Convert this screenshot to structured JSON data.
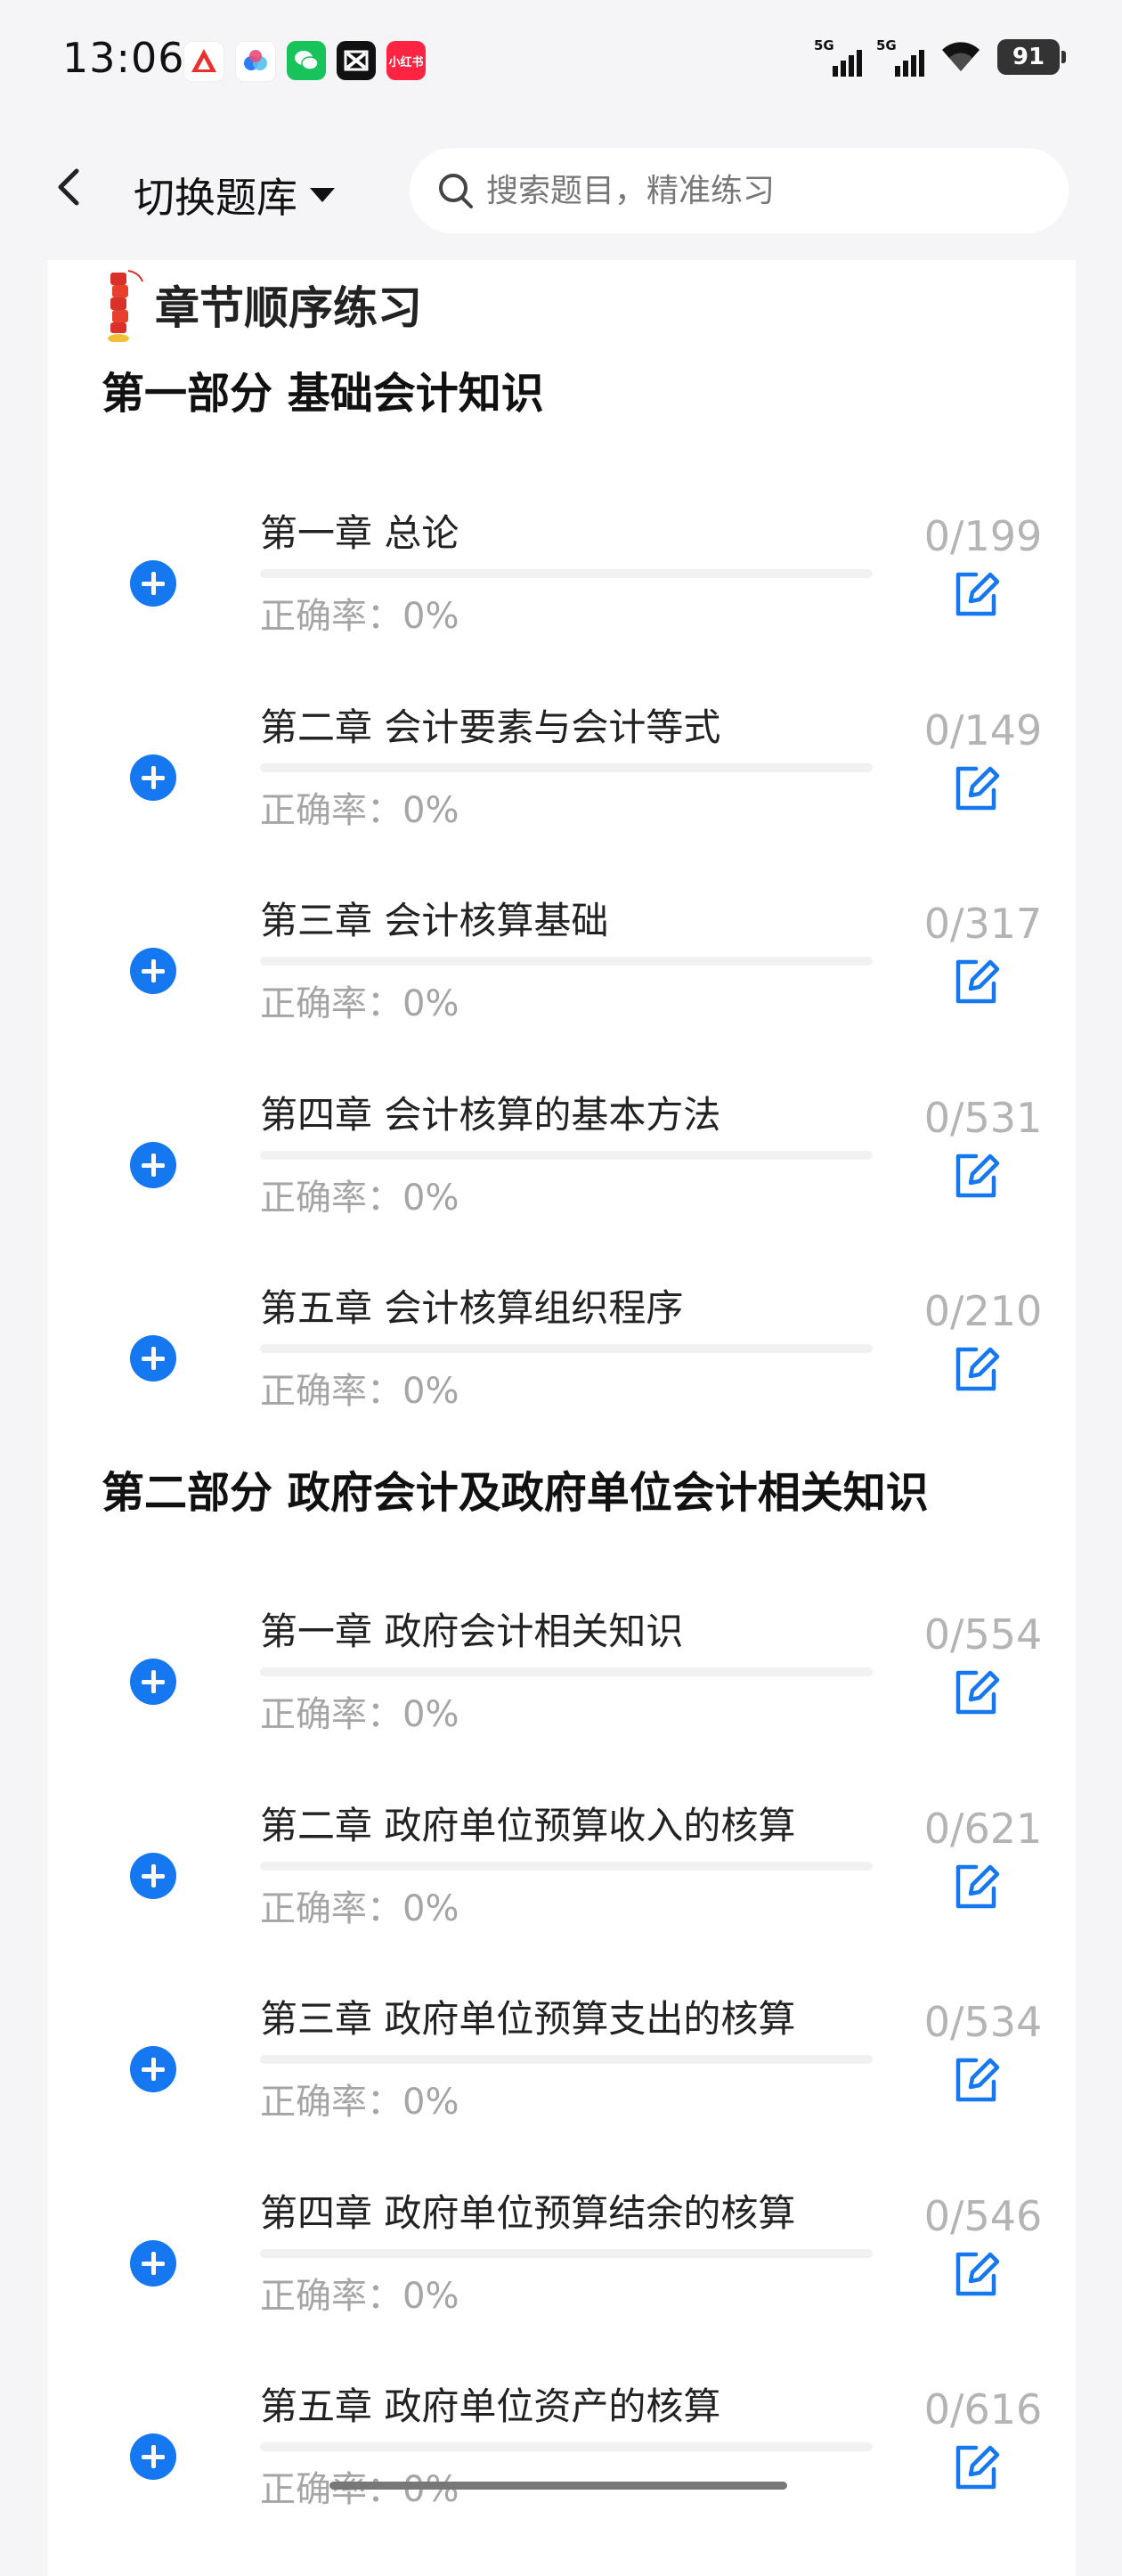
{
  "status": {
    "time": "13:06",
    "battery": "91",
    "network1": "5G",
    "network2": "5G",
    "app_icons": [
      "app-icon-red",
      "baidu-netdisk-icon",
      "wechat-icon",
      "capcut-icon",
      "xiaohongshu-icon"
    ],
    "xiaohongshu_label": "小红书"
  },
  "nav": {
    "switch_label": "切换题库",
    "search_placeholder": "搜索题目，精准练习"
  },
  "section": {
    "title": "章节顺序练习"
  },
  "parts": [
    {
      "title": "第一部分 基础会计知识",
      "chapters": [
        {
          "title": "第一章 总论",
          "accuracy_label": "正确率：",
          "accuracy": "0%",
          "done": 0,
          "total": 199,
          "count": "0/199"
        },
        {
          "title": "第二章 会计要素与会计等式",
          "accuracy_label": "正确率：",
          "accuracy": "0%",
          "done": 0,
          "total": 149,
          "count": "0/149"
        },
        {
          "title": "第三章 会计核算基础",
          "accuracy_label": "正确率：",
          "accuracy": "0%",
          "done": 0,
          "total": 317,
          "count": "0/317"
        },
        {
          "title": "第四章 会计核算的基本方法",
          "accuracy_label": "正确率：",
          "accuracy": "0%",
          "done": 0,
          "total": 531,
          "count": "0/531"
        },
        {
          "title": "第五章 会计核算组织程序",
          "accuracy_label": "正确率：",
          "accuracy": "0%",
          "done": 0,
          "total": 210,
          "count": "0/210"
        }
      ]
    },
    {
      "title": "第二部分 政府会计及政府单位会计相关知识",
      "chapters": [
        {
          "title": "第一章 政府会计相关知识",
          "accuracy_label": "正确率：",
          "accuracy": "0%",
          "done": 0,
          "total": 554,
          "count": "0/554"
        },
        {
          "title": "第二章 政府单位预算收入的核算",
          "accuracy_label": "正确率：",
          "accuracy": "0%",
          "done": 0,
          "total": 621,
          "count": "0/621"
        },
        {
          "title": "第三章 政府单位预算支出的核算",
          "accuracy_label": "正确率：",
          "accuracy": "0%",
          "done": 0,
          "total": 534,
          "count": "0/534"
        },
        {
          "title": "第四章 政府单位预算结余的核算",
          "accuracy_label": "正确率：",
          "accuracy": "0%",
          "done": 0,
          "total": 546,
          "count": "0/546"
        },
        {
          "title": "第五章 政府单位资产的核算",
          "accuracy_label": "正确率：",
          "accuracy": "0%",
          "done": 0,
          "total": 616,
          "count": "0/616"
        }
      ]
    }
  ],
  "colors": {
    "accent": "#1578f0",
    "muted_text": "#a5a5a5",
    "count_text": "#b4b4b4",
    "highlight": "#cfe3f6"
  }
}
